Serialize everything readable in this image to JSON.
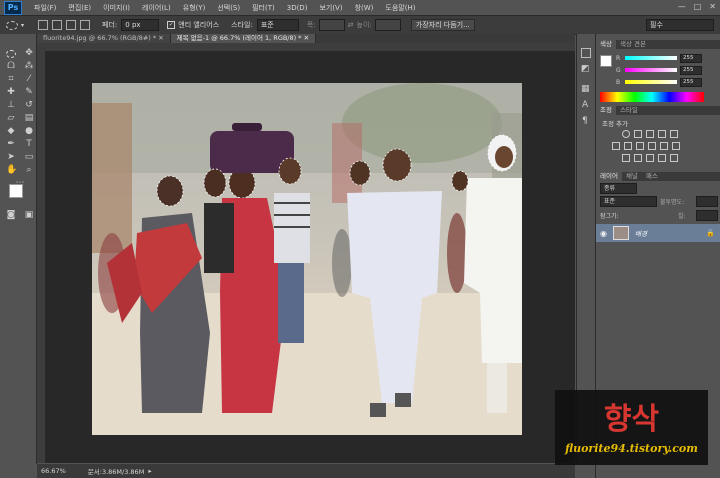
{
  "menubar": {
    "logo": "Ps",
    "items": [
      "파일(F)",
      "편집(E)",
      "이미지(I)",
      "레이어(L)",
      "유형(Y)",
      "선택(S)",
      "필터(T)",
      "3D(D)",
      "보기(V)",
      "창(W)",
      "도움말(H)"
    ],
    "window_buttons": [
      "—",
      "□",
      "✕"
    ]
  },
  "options": {
    "feather_label": "페더:",
    "feather_value": "0 px",
    "antialias_label": "앤티 앨리어스",
    "style_label": "스타일:",
    "style_value": "표준",
    "width_label": "폭:",
    "height_label": "높이:",
    "refine_edge": "가장자리 다듬기...",
    "workspace": "필수"
  },
  "tabs": [
    {
      "label": "fluorite94.jpg @ 66.7% (RGB/8#) *",
      "active": false
    },
    {
      "label": "제목 없음-1 @ 66.7% (레이어 1, RGB/8) *",
      "active": true
    }
  ],
  "status": {
    "zoom": "66.67%",
    "doc_info": "문서:3.86M/3.86M"
  },
  "right_panel": {
    "color_tabs": [
      "색상",
      "색상 견본"
    ],
    "sliders": [
      {
        "label": "R",
        "value": "255",
        "gradient": "linear-gradient(to right,#00ffff,#ffffff)"
      },
      {
        "label": "G",
        "value": "255",
        "gradient": "linear-gradient(to right,#ff00ff,#ffffff)"
      },
      {
        "label": "B",
        "value": "255",
        "gradient": "linear-gradient(to right,#ffff00,#ffffff)"
      }
    ],
    "adjust_tabs": [
      "조정",
      "스타일"
    ],
    "adjust_title": "조정 추가",
    "layer_tabs": [
      "레이어",
      "채널",
      "패스"
    ],
    "kind_label": "종류",
    "blend_mode": "표준",
    "opacity_label": "불투명도:",
    "lock_label": "잠그기:",
    "fill_label": "칠:",
    "layer_name": "배경"
  },
  "watermark": {
    "title": "향삭",
    "url": "fluorite94.tistory.com"
  },
  "colors": {
    "app_bg": "#535353",
    "canvas_bg": "#282828",
    "layer_selected": "#6b7e98",
    "watermark_title": "#e3342f",
    "watermark_url": "#f2c500"
  }
}
